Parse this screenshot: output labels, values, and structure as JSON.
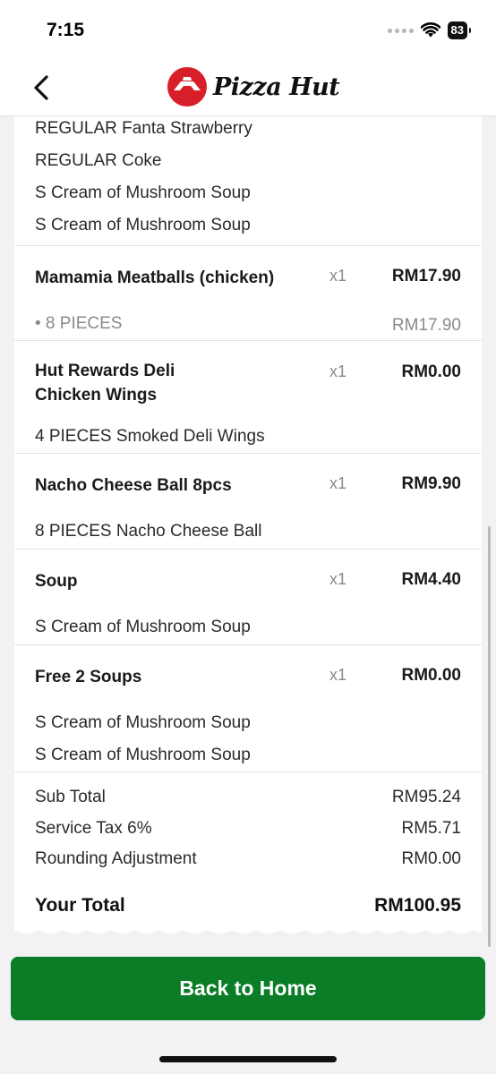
{
  "status_bar": {
    "time": "7:15",
    "battery": "83"
  },
  "header": {
    "logo_text": "Pizza Hut"
  },
  "top_lines": [
    "REGULAR Fanta Strawberry",
    "REGULAR Coke",
    "S Cream of Mushroom Soup",
    "S Cream of Mushroom Soup"
  ],
  "items": [
    {
      "name": "Mamamia Meatballs (chicken)",
      "qty": "x1",
      "price": "RM17.90",
      "sub": "• 8 PIECES",
      "sub_price": "RM17.90"
    },
    {
      "name_line1": "Hut Rewards Deli",
      "name_line2": "Chicken Wings",
      "qty": "x1",
      "price": "RM0.00",
      "sub": "4 PIECES Smoked Deli Wings"
    },
    {
      "name": "Nacho Cheese Ball 8pcs",
      "qty": "x1",
      "price": "RM9.90",
      "sub": "8 PIECES Nacho Cheese Ball"
    },
    {
      "name": "Soup",
      "qty": "x1",
      "price": "RM4.40",
      "sub": "S Cream of Mushroom Soup"
    },
    {
      "name": "Free 2 Soups",
      "qty": "x1",
      "price": "RM0.00",
      "sub": "S Cream of Mushroom Soup",
      "sub2": "S Cream of Mushroom Soup"
    }
  ],
  "summary": {
    "subtotal_label": "Sub Total",
    "subtotal_value": "RM95.24",
    "tax_label": "Service Tax 6%",
    "tax_value": "RM5.71",
    "rounding_label": "Rounding Adjustment",
    "rounding_value": "RM0.00",
    "total_label": "Your Total",
    "total_value": "RM100.95"
  },
  "footer": {
    "button_label": "Back to Home"
  },
  "colors": {
    "brand_red": "#d71f2a",
    "button_green": "#0a7d26"
  }
}
